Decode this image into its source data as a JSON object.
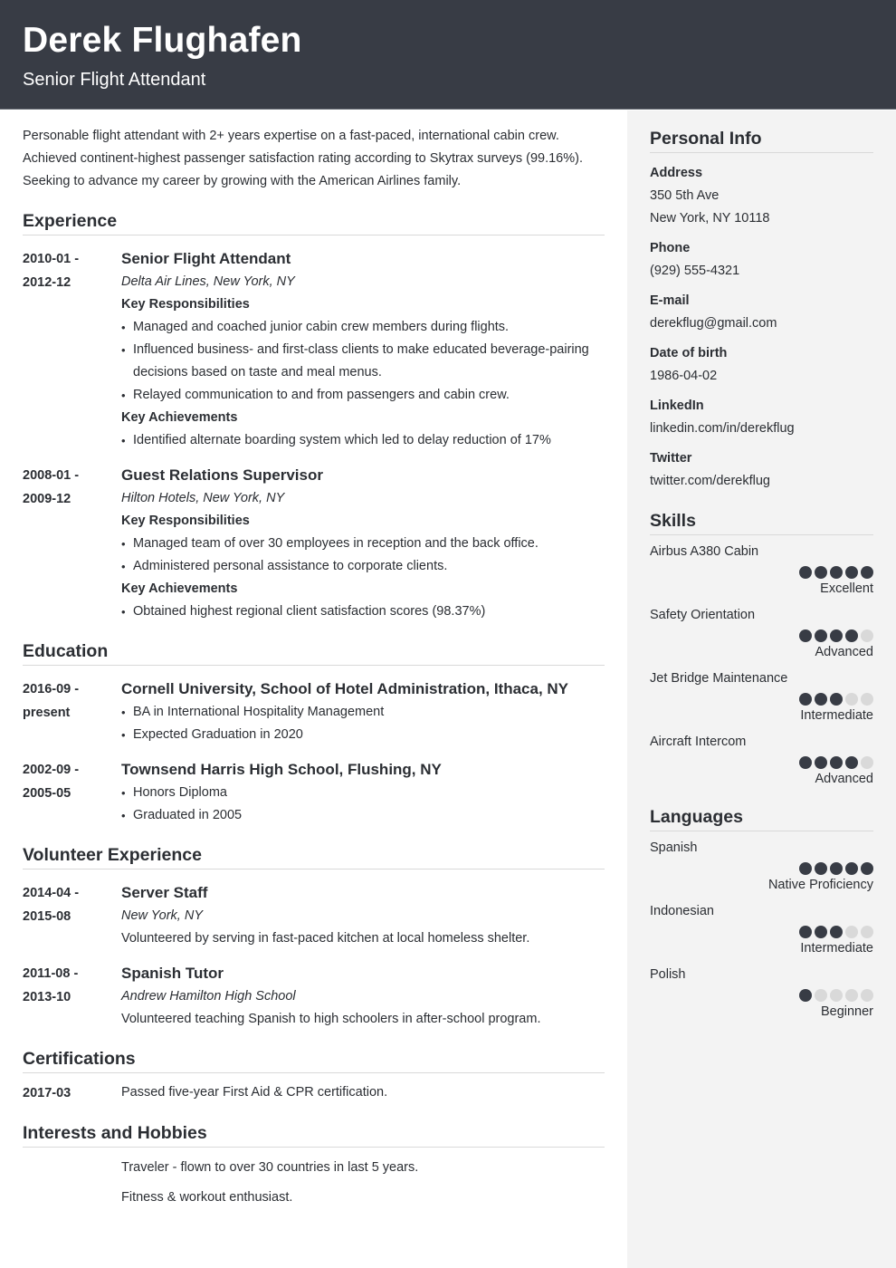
{
  "header": {
    "name": "Derek Flughafen",
    "title": "Senior Flight Attendant"
  },
  "summary": [
    "Personable flight attendant with 2+ years expertise on a fast-paced, international cabin crew.",
    "Achieved continent-highest passenger satisfaction rating according to Skytrax surveys (99.16%).",
    "Seeking to advance my career by growing with the American Airlines family."
  ],
  "experience": {
    "title": "Experience",
    "entries": [
      {
        "date_start": "2010-01 -",
        "date_end": "2012-12",
        "job_title": "Senior Flight Attendant",
        "company": "Delta Air Lines, New York, NY",
        "responsibilities_label": "Key Responsibilities",
        "responsibilities": [
          "Managed and coached junior cabin crew members during flights.",
          "Influenced business- and first-class clients to make educated beverage-pairing decisions based on taste and meal menus.",
          "Relayed communication to and from passengers and cabin crew."
        ],
        "achievements_label": "Key Achievements",
        "achievements": [
          "Identified alternate boarding system which led to delay reduction of 17%"
        ]
      },
      {
        "date_start": "2008-01 -",
        "date_end": "2009-12",
        "job_title": "Guest Relations Supervisor",
        "company": "Hilton Hotels, New York, NY",
        "responsibilities_label": "Key Responsibilities",
        "responsibilities": [
          "Managed team of over 30 employees in reception and the back office.",
          "Administered personal assistance to corporate clients."
        ],
        "achievements_label": "Key Achievements",
        "achievements": [
          "Obtained highest regional client satisfaction scores (98.37%)"
        ]
      }
    ]
  },
  "education": {
    "title": "Education",
    "entries": [
      {
        "date_start": "2016-09 -",
        "date_end": "present",
        "school": "Cornell University, School of Hotel Administration, Ithaca, NY",
        "items": [
          "BA in International Hospitality Management",
          "Expected Graduation in 2020"
        ]
      },
      {
        "date_start": "2002-09 -",
        "date_end": "2005-05",
        "school": "Townsend Harris High School, Flushing, NY",
        "items": [
          "Honors Diploma",
          "Graduated in 2005"
        ]
      }
    ]
  },
  "volunteer": {
    "title": "Volunteer Experience",
    "entries": [
      {
        "date_start": "2014-04 -",
        "date_end": "2015-08",
        "role": "Server Staff",
        "org": "New York, NY",
        "description": "Volunteered by serving in fast-paced kitchen at local homeless shelter."
      },
      {
        "date_start": "2011-08 -",
        "date_end": "2013-10",
        "role": "Spanish Tutor",
        "org": "Andrew Hamilton High School",
        "description": "Volunteered teaching Spanish to high schoolers in after-school program."
      }
    ]
  },
  "certifications": {
    "title": "Certifications",
    "entries": [
      {
        "date": "2017-03",
        "text": "Passed five-year First Aid & CPR certification."
      }
    ]
  },
  "interests": {
    "title": "Interests and Hobbies",
    "items": [
      "Traveler - flown to over 30 countries in last 5 years.",
      "Fitness & workout enthusiast."
    ]
  },
  "personal_info": {
    "title": "Personal Info",
    "address_label": "Address",
    "address_line1": "350 5th Ave",
    "address_line2": "New York, NY 10118",
    "phone_label": "Phone",
    "phone": "(929) 555-4321",
    "email_label": "E-mail",
    "email": "derekflug@gmail.com",
    "dob_label": "Date of birth",
    "dob": "1986-04-02",
    "linkedin_label": "LinkedIn",
    "linkedin": "linkedin.com/in/derekflug",
    "twitter_label": "Twitter",
    "twitter": "twitter.com/derekflug"
  },
  "skills": {
    "title": "Skills",
    "max_rating": 5,
    "items": [
      {
        "name": "Airbus A380 Cabin",
        "rating": 5,
        "level": "Excellent"
      },
      {
        "name": "Safety Orientation",
        "rating": 4,
        "level": "Advanced"
      },
      {
        "name": "Jet Bridge Maintenance",
        "rating": 3,
        "level": "Intermediate"
      },
      {
        "name": "Aircraft Intercom",
        "rating": 4,
        "level": "Advanced"
      }
    ]
  },
  "languages": {
    "title": "Languages",
    "max_rating": 5,
    "items": [
      {
        "name": "Spanish",
        "rating": 5,
        "level": "Native Proficiency"
      },
      {
        "name": "Indonesian",
        "rating": 3,
        "level": "Intermediate"
      },
      {
        "name": "Polish",
        "rating": 1,
        "level": "Beginner"
      }
    ]
  },
  "colors": {
    "header_bg": "#383c45",
    "sidebar_bg": "#f3f3f3",
    "dot_filled": "#383c45",
    "dot_empty": "#d9d9d9",
    "text": "#2b2e33"
  }
}
